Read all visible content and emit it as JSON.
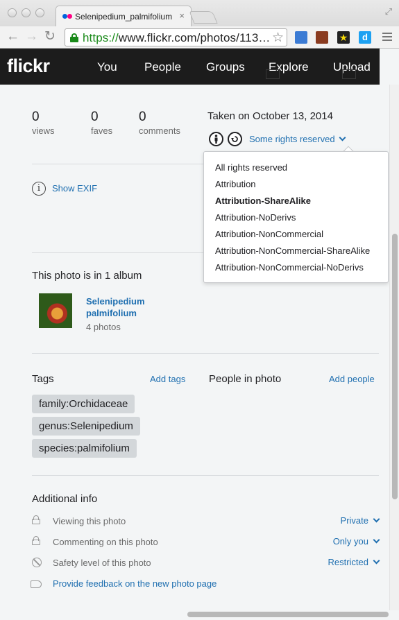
{
  "browser": {
    "tab_title": "Selenipedium_palmifolium",
    "tab_close": "×",
    "url_scheme": "https://",
    "url_rest": "www.flickr.com/photos/113…"
  },
  "flickr": {
    "logo": "flickr",
    "nav": [
      "You",
      "People",
      "Groups",
      "Explore",
      "Upload"
    ]
  },
  "stats": [
    {
      "value": "0",
      "label": "views"
    },
    {
      "value": "0",
      "label": "faves"
    },
    {
      "value": "0",
      "label": "comments"
    }
  ],
  "taken": "Taken on October 13, 2014",
  "license": {
    "current": "Some rights reserved",
    "options": [
      "All rights reserved",
      "Attribution",
      "Attribution-ShareAlike",
      "Attribution-NoDerivs",
      "Attribution-NonCommercial",
      "Attribution-NonCommercial-ShareAlike",
      "Attribution-NonCommercial-NoDerivs"
    ],
    "selected_index": 2
  },
  "exif": {
    "label": "Show EXIF"
  },
  "album": {
    "heading": "This photo is in 1 album",
    "title": "Selenipedium palmifolium",
    "count": "4 photos"
  },
  "tags": {
    "heading": "Tags",
    "add_label": "Add tags",
    "items": [
      "family:Orchidaceae",
      "genus:Selenipedium",
      "species:palmifolium"
    ]
  },
  "people": {
    "heading": "People in photo",
    "add_label": "Add people"
  },
  "additional": {
    "heading": "Additional info",
    "rows": [
      {
        "label": "Viewing this photo",
        "value": "Private",
        "icon": "lock-icon"
      },
      {
        "label": "Commenting on this photo",
        "value": "Only you",
        "icon": "lock-icon"
      },
      {
        "label": "Safety level of this photo",
        "value": "Restricted",
        "icon": "safety-icon"
      }
    ],
    "feedback": "Provide feedback on the new photo page"
  },
  "colors": {
    "link": "#1f6fb0",
    "header_bg": "#1c1c1c",
    "page_bg": "#f3f5f6",
    "tag_bg": "#d3d7da"
  }
}
